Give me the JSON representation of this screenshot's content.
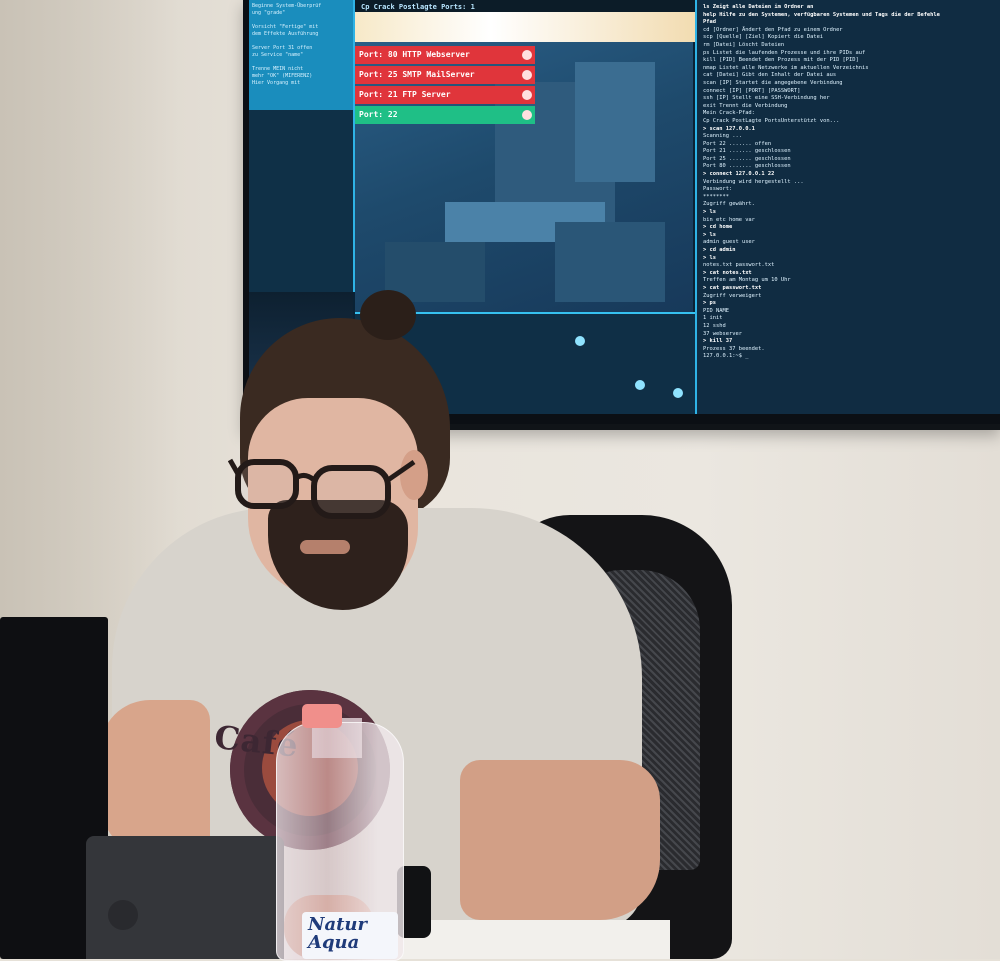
{
  "scene": {
    "description_colors": {
      "wall": "#e6e1d8",
      "screen_bg": "#0a2235",
      "accent_cyan": "#2fb3e6",
      "port_red": "#e0353b",
      "port_green": "#1fbf86",
      "bottle_cap": "#f08f8b"
    }
  },
  "tv_screen": {
    "left_pane_lines": [
      "Beginne System-Überprüf",
      "ung \"grade\"",
      "",
      "Vorsicht \"Fertige\" mit",
      "dem Effekte Ausführung",
      "",
      "Server Port 31 offen",
      "zu Service \"name\"",
      "",
      "Trenne MEIN nicht",
      "mehr \"OK\" (MIFERENZ)",
      "Hier Vorgang mit"
    ],
    "game_header": "Cp Crack Postlagte Ports: 1",
    "ports": [
      {
        "label": "Port: 80",
        "detail": "HTTP Webserver",
        "status": "closed",
        "color": "#e0353b"
      },
      {
        "label": "Port: 25",
        "detail": "SMTP MailServer",
        "status": "closed",
        "color": "#e0353b"
      },
      {
        "label": "Port: 21",
        "detail": "FTP Server",
        "status": "closed",
        "color": "#e0353b"
      },
      {
        "label": "Port: 22",
        "detail": "",
        "status": "open",
        "color": "#1fbf86"
      }
    ],
    "terminal_lines": [
      "ls   Zeigt alle Dateien im Ordner an",
      "help Hilfe zu den Systemen, verfügbaren Systemen und Tags die der Befehle",
      "Pfad",
      "cd [Ordner]  Ändert den Pfad zu einem Ordner",
      "scp [Quelle] [Ziel] Kopiert die Datei",
      "rm [Datei]   Löscht Dateien",
      "ps           Listet die laufenden Prozesse und ihre PIDs auf",
      "kill [PID]   Beendet den Prozess mit der PID [PID]",
      "",
      "nmap         Listet alle Netzwerke im aktuellen Verzeichnis",
      "cat [Datei]  Gibt den Inhalt der Datei aus",
      "scan [IP]    Startet die angegebene Verbindung",
      "",
      "connect [IP] [PORT] [PASSWORT]",
      "ssh [IP]     Stellt eine SSH-Verbindung her",
      "exit         Trennt die Verbindung",
      "",
      "Mein Crack-Pfad:",
      "Cp Crack PostLagte PortsUnterstützt von...",
      "",
      "> scan 127.0.0.1",
      "Scanning ...",
      "Port 22 ....... offen",
      "Port 21 ....... geschlossen",
      "Port 25 ....... geschlossen",
      "Port 80 ....... geschlossen",
      "",
      "> connect 127.0.0.1 22",
      "Verbindung wird hergestellt ...",
      "Passwort:",
      "********",
      "Zugriff gewährt.",
      "",
      "> ls",
      "bin   etc   home   var",
      "> cd home",
      "> ls",
      "admin  guest  user",
      "> cd admin",
      "> ls",
      "notes.txt  passwort.txt",
      "> cat notes.txt",
      "Treffen am Montag um 10 Uhr",
      "> cat passwort.txt",
      "Zugriff verweigert",
      "",
      "> ps",
      "PID  NAME",
      "1    init",
      "12   sshd",
      "37   webserver",
      "",
      "> kill 37",
      "Prozess 37 beendet.",
      "",
      "127.0.0.1:~$ _"
    ]
  },
  "shirt_print": "Café",
  "bottle": {
    "label_text": "Natur\nAqua"
  }
}
